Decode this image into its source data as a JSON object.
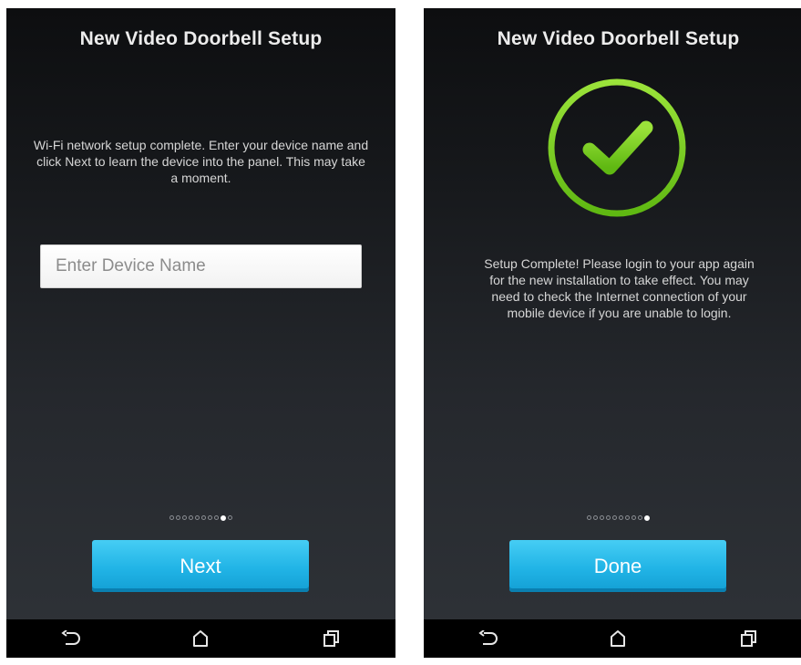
{
  "screens": [
    {
      "title": "New Video Doorbell Setup",
      "message": "Wi-Fi network setup complete. Enter your device name and click Next to learn the device into the panel. This may take a moment.",
      "device_name_input": {
        "placeholder": "Enter Device Name",
        "value": ""
      },
      "pager": {
        "total": 9,
        "active_index": 8
      },
      "primary_button_label": "Next",
      "nav_icons": [
        "back-icon",
        "home-icon",
        "recent-apps-icon"
      ]
    },
    {
      "title": "New Video Doorbell Setup",
      "status_icon": "success-checkmark-icon",
      "message": "Setup Complete! Please login to your app again for the new installation to take effect. You may need to check the Internet connection of your mobile device if you are unable to login.",
      "pager": {
        "total": 9,
        "active_index": 9
      },
      "primary_button_label": "Done",
      "nav_icons": [
        "back-icon",
        "home-icon",
        "recent-apps-icon"
      ]
    }
  ],
  "colors": {
    "accent_button": "#21b4e6",
    "success_green": "#7ed321",
    "screen_bg_top": "#0d0e10",
    "screen_bg_bottom": "#2f3338"
  }
}
